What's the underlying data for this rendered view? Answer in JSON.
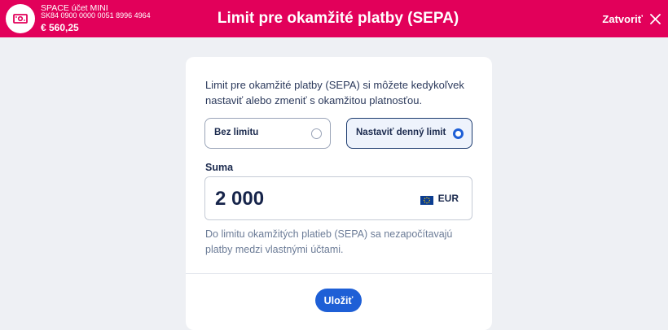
{
  "header": {
    "account_name": "SPACE účet MINI",
    "account_iban": "SK84 0900 0000 0051 8996 4964",
    "account_balance": "€ 560,25",
    "account_icon": "banknote-icon",
    "title": "Limit pre okamžité platby (SEPA)",
    "close_label": "Zatvoriť",
    "close_icon": "close-icon",
    "brand_color": "#e2005a"
  },
  "form": {
    "intro": "Limit pre okamžité platby (SEPA) si môžete kedykoľvek nastaviť alebo zmeniť s okamžitou platnosťou.",
    "options": [
      {
        "label": "Bez limitu",
        "selected": false
      },
      {
        "label": "Nastaviť denný limit",
        "selected": true
      }
    ],
    "amount_label": "Suma",
    "amount_value": "2 000",
    "currency": "EUR",
    "currency_icon": "eu-flag-icon",
    "note": "Do limitu okamžitých platieb (SEPA) sa nezapočítavajú platby medzi vlastnými účtami.",
    "save_label": "Uložiť",
    "accent_color": "#1e5fd6"
  }
}
